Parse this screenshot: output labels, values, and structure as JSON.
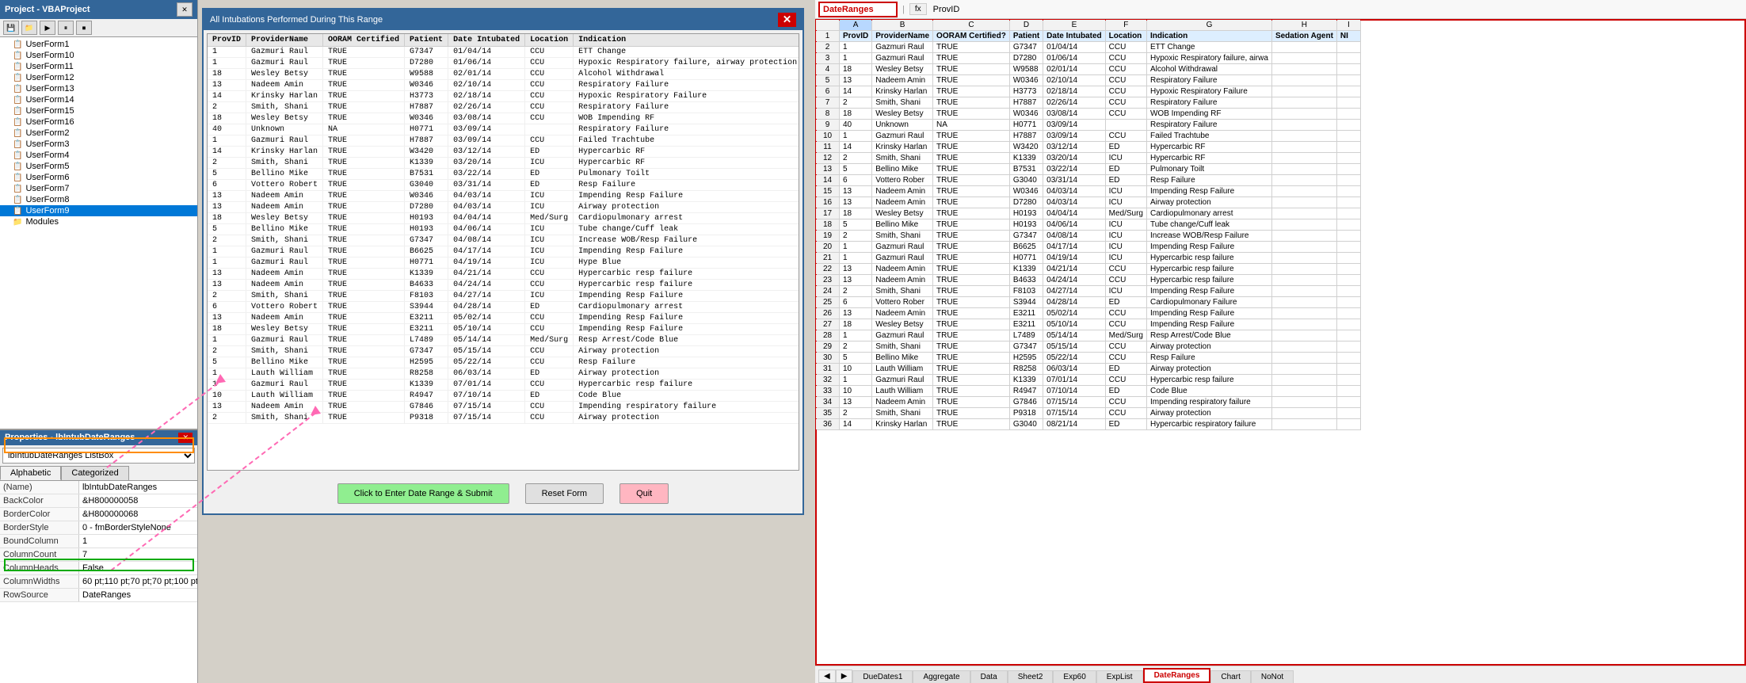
{
  "vba": {
    "title": "Project - VBAProject",
    "toolbar": [
      "save",
      "folder",
      "settings"
    ],
    "tree": [
      {
        "label": "UserForm1",
        "indent": 1,
        "type": "form"
      },
      {
        "label": "UserForm10",
        "indent": 1,
        "type": "form"
      },
      {
        "label": "UserForm11",
        "indent": 1,
        "type": "form"
      },
      {
        "label": "UserForm12",
        "indent": 1,
        "type": "form"
      },
      {
        "label": "UserForm13",
        "indent": 1,
        "type": "form"
      },
      {
        "label": "UserForm14",
        "indent": 1,
        "type": "form"
      },
      {
        "label": "UserForm15",
        "indent": 1,
        "type": "form"
      },
      {
        "label": "UserForm16",
        "indent": 1,
        "type": "form"
      },
      {
        "label": "UserForm2",
        "indent": 1,
        "type": "form"
      },
      {
        "label": "UserForm3",
        "indent": 1,
        "type": "form"
      },
      {
        "label": "UserForm4",
        "indent": 1,
        "type": "form"
      },
      {
        "label": "UserForm5",
        "indent": 1,
        "type": "form"
      },
      {
        "label": "UserForm6",
        "indent": 1,
        "type": "form"
      },
      {
        "label": "UserForm7",
        "indent": 1,
        "type": "form"
      },
      {
        "label": "UserForm8",
        "indent": 1,
        "type": "form"
      },
      {
        "label": "UserForm9",
        "indent": 1,
        "type": "form",
        "selected": true
      },
      {
        "label": "Modules",
        "indent": 1,
        "type": "folder"
      }
    ]
  },
  "properties": {
    "title": "Properties - lbIntubDateRanges",
    "dropdown_value": "lbIntubDateRanges ListBox",
    "tabs": [
      "Alphabetic",
      "Categorized"
    ],
    "active_tab": "Alphabetic",
    "rows": [
      {
        "name": "(Name)",
        "value": "lbIntubDateRanges"
      },
      {
        "name": "BackColor",
        "value": "&H800000058"
      },
      {
        "name": "BorderColor",
        "value": "&H800000068"
      },
      {
        "name": "BorderStyle",
        "value": "0 - fmBorderStyleNone"
      },
      {
        "name": "BoundColumn",
        "value": "1"
      },
      {
        "name": "ColumnCount",
        "value": "7"
      },
      {
        "name": "ColumnHeads",
        "value": "False"
      },
      {
        "name": "ColumnWidths",
        "value": "60 pt;110 pt;70 pt;70 pt;100 pt;70 pt;70 pt"
      },
      {
        "name": "RowSource",
        "value": "DateRanges"
      }
    ]
  },
  "dialog": {
    "title": "All Intubations Performed During This Range",
    "columns": [
      "ProvID",
      "ProviderName",
      "OORAM Certified",
      "Patient",
      "Date Intubated",
      "Location",
      "Indication"
    ],
    "rows": [
      {
        "provid": "1",
        "name": "Gazmuri Raul",
        "cert": "TRUE",
        "patient": "G7347",
        "date": "01/04/14",
        "loc": "CCU",
        "indication": "ETT Change"
      },
      {
        "provid": "1",
        "name": "Gazmuri Raul",
        "cert": "TRUE",
        "patient": "D7280",
        "date": "01/06/14",
        "loc": "CCU",
        "indication": "Hypoxic Respiratory failure, airway protection"
      },
      {
        "provid": "18",
        "name": "Wesley Betsy",
        "cert": "TRUE",
        "patient": "W9588",
        "date": "02/01/14",
        "loc": "CCU",
        "indication": "Alcohol Withdrawal"
      },
      {
        "provid": "13",
        "name": "Nadeem Amin",
        "cert": "TRUE",
        "patient": "W0346",
        "date": "02/10/14",
        "loc": "CCU",
        "indication": "Respiratory Failure"
      },
      {
        "provid": "14",
        "name": "Krinsky Harlan",
        "cert": "TRUE",
        "patient": "H3773",
        "date": "02/18/14",
        "loc": "CCU",
        "indication": "Hypoxic Respiratory Failure"
      },
      {
        "provid": "2",
        "name": "Smith, Shani",
        "cert": "TRUE",
        "patient": "H7887",
        "date": "02/26/14",
        "loc": "CCU",
        "indication": "Respiratory Failure"
      },
      {
        "provid": "18",
        "name": "Wesley Betsy",
        "cert": "TRUE",
        "patient": "W0346",
        "date": "03/08/14",
        "loc": "CCU",
        "indication": "WOB Impending RF"
      },
      {
        "provid": "40",
        "name": "Unknown",
        "cert": "NA",
        "patient": "H0771",
        "date": "03/09/14",
        "loc": "",
        "indication": "Respiratory Failure"
      },
      {
        "provid": "1",
        "name": "Gazmuri Raul",
        "cert": "TRUE",
        "patient": "H7887",
        "date": "03/09/14",
        "loc": "CCU",
        "indication": "Failed Trachtube"
      },
      {
        "provid": "14",
        "name": "Krinsky Harlan",
        "cert": "TRUE",
        "patient": "W3420",
        "date": "03/12/14",
        "loc": "ED",
        "indication": "Hypercarbic RF"
      },
      {
        "provid": "2",
        "name": "Smith, Shani",
        "cert": "TRUE",
        "patient": "K1339",
        "date": "03/20/14",
        "loc": "ICU",
        "indication": "Hypercarbic RF"
      },
      {
        "provid": "5",
        "name": "Bellino Mike",
        "cert": "TRUE",
        "patient": "B7531",
        "date": "03/22/14",
        "loc": "ED",
        "indication": "Pulmonary Toilt"
      },
      {
        "provid": "6",
        "name": "Vottero Robert",
        "cert": "TRUE",
        "patient": "G3040",
        "date": "03/31/14",
        "loc": "ED",
        "indication": "Resp Failure"
      },
      {
        "provid": "13",
        "name": "Nadeem Amin",
        "cert": "TRUE",
        "patient": "W0346",
        "date": "04/03/14",
        "loc": "ICU",
        "indication": "Impending Resp Failure"
      },
      {
        "provid": "13",
        "name": "Nadeem Amin",
        "cert": "TRUE",
        "patient": "D7280",
        "date": "04/03/14",
        "loc": "ICU",
        "indication": "Airway protection"
      },
      {
        "provid": "18",
        "name": "Wesley Betsy",
        "cert": "TRUE",
        "patient": "H0193",
        "date": "04/04/14",
        "loc": "Med/Surg",
        "indication": "Cardiopulmonary arrest"
      },
      {
        "provid": "5",
        "name": "Bellino Mike",
        "cert": "TRUE",
        "patient": "H0193",
        "date": "04/06/14",
        "loc": "ICU",
        "indication": "Tube change/Cuff leak"
      },
      {
        "provid": "2",
        "name": "Smith, Shani",
        "cert": "TRUE",
        "patient": "G7347",
        "date": "04/08/14",
        "loc": "ICU",
        "indication": "Increase WOB/Resp Failure"
      },
      {
        "provid": "1",
        "name": "Gazmuri Raul",
        "cert": "TRUE",
        "patient": "B6625",
        "date": "04/17/14",
        "loc": "ICU",
        "indication": "Impending Resp Failure"
      },
      {
        "provid": "1",
        "name": "Gazmuri Raul",
        "cert": "TRUE",
        "patient": "H0771",
        "date": "04/19/14",
        "loc": "ICU",
        "indication": "Hype Blue"
      },
      {
        "provid": "13",
        "name": "Nadeem Amin",
        "cert": "TRUE",
        "patient": "K1339",
        "date": "04/21/14",
        "loc": "CCU",
        "indication": "Hypercarbic resp failure"
      },
      {
        "provid": "13",
        "name": "Nadeem Amin",
        "cert": "TRUE",
        "patient": "B4633",
        "date": "04/24/14",
        "loc": "CCU",
        "indication": "Hypercarbic resp failure"
      },
      {
        "provid": "2",
        "name": "Smith, Shani",
        "cert": "TRUE",
        "patient": "F8103",
        "date": "04/27/14",
        "loc": "ICU",
        "indication": "Impending Resp Failure"
      },
      {
        "provid": "6",
        "name": "Vottero Robert",
        "cert": "TRUE",
        "patient": "S3944",
        "date": "04/28/14",
        "loc": "ED",
        "indication": "Cardiopulmonary arrest"
      },
      {
        "provid": "13",
        "name": "Nadeem Amin",
        "cert": "TRUE",
        "patient": "E3211",
        "date": "05/02/14",
        "loc": "CCU",
        "indication": "Impending Resp Failure"
      },
      {
        "provid": "18",
        "name": "Wesley Betsy",
        "cert": "TRUE",
        "patient": "E3211",
        "date": "05/10/14",
        "loc": "CCU",
        "indication": "Impending Resp Failure"
      },
      {
        "provid": "1",
        "name": "Gazmuri Raul",
        "cert": "TRUE",
        "patient": "L7489",
        "date": "05/14/14",
        "loc": "Med/Surg",
        "indication": "Resp Arrest/Code Blue"
      },
      {
        "provid": "2",
        "name": "Smith, Shani",
        "cert": "TRUE",
        "patient": "G7347",
        "date": "05/15/14",
        "loc": "CCU",
        "indication": "Airway protection"
      },
      {
        "provid": "5",
        "name": "Bellino Mike",
        "cert": "TRUE",
        "patient": "H2595",
        "date": "05/22/14",
        "loc": "CCU",
        "indication": "Resp Failure"
      },
      {
        "provid": "1",
        "name": "Lauth William",
        "cert": "TRUE",
        "patient": "R8258",
        "date": "06/03/14",
        "loc": "ED",
        "indication": "Airway protection"
      },
      {
        "provid": "1",
        "name": "Gazmuri Raul",
        "cert": "TRUE",
        "patient": "K1339",
        "date": "07/01/14",
        "loc": "CCU",
        "indication": "Hypercarbic resp failure"
      },
      {
        "provid": "10",
        "name": "Lauth William",
        "cert": "TRUE",
        "patient": "R4947",
        "date": "07/10/14",
        "loc": "ED",
        "indication": "Code Blue"
      },
      {
        "provid": "13",
        "name": "Nadeem Amin",
        "cert": "TRUE",
        "patient": "G7846",
        "date": "07/15/14",
        "loc": "CCU",
        "indication": "Impending respiratory failure"
      },
      {
        "provid": "2",
        "name": "Smith, Shani",
        "cert": "TRUE",
        "patient": "P9318",
        "date": "07/15/14",
        "loc": "CCU",
        "indication": "Airway protection"
      }
    ],
    "buttons": [
      {
        "label": "Click to Enter Date Range & Submit",
        "type": "green"
      },
      {
        "label": "Reset Form",
        "type": "default"
      },
      {
        "label": "Quit",
        "type": "pink"
      }
    ]
  },
  "excel": {
    "name_box": "DateRanges",
    "formula": "ProvID",
    "columns": [
      "A",
      "B",
      "C",
      "D",
      "E",
      "F",
      "G",
      "H"
    ],
    "headers": [
      "ProvID",
      "ProviderName",
      "OORAM Certified?",
      "Patient",
      "Date Intubated",
      "Location",
      "Indication",
      "Sedation Agent",
      "NI"
    ],
    "rows": [
      {
        "row": 1,
        "a": "ProvID",
        "b": "ProviderName",
        "c": "OORAM Certified?",
        "d": "Patient",
        "e": "Date Intubated",
        "f": "Location",
        "g": "Indication",
        "h": "Sedation Agent",
        "i": "NI"
      },
      {
        "row": 2,
        "a": "1",
        "b": "Gazmuri Raul",
        "c": "TRUE",
        "d": "G7347",
        "e": "01/04/14",
        "f": "CCU",
        "g": "ETT Change",
        "h": "",
        "i": ""
      },
      {
        "row": 3,
        "a": "1",
        "b": "Gazmuri Raul",
        "c": "TRUE",
        "d": "D7280",
        "e": "01/06/14",
        "f": "CCU",
        "g": "Hypoxic Respiratory failure, airwa",
        "h": "",
        "i": ""
      },
      {
        "row": 4,
        "a": "18",
        "b": "Wesley Betsy",
        "c": "TRUE",
        "d": "W9588",
        "e": "02/01/14",
        "f": "CCU",
        "g": "Alcohol Withdrawal",
        "h": "",
        "i": ""
      },
      {
        "row": 5,
        "a": "13",
        "b": "Nadeem Amin",
        "c": "TRUE",
        "d": "W0346",
        "e": "02/10/14",
        "f": "CCU",
        "g": "Respiratory Failure",
        "h": "",
        "i": ""
      },
      {
        "row": 6,
        "a": "14",
        "b": "Krinsky Harlan",
        "c": "TRUE",
        "d": "H3773",
        "e": "02/18/14",
        "f": "CCU",
        "g": "Hypoxic Respiratory Failure",
        "h": "",
        "i": ""
      },
      {
        "row": 7,
        "a": "2",
        "b": "Smith, Shani",
        "c": "TRUE",
        "d": "H7887",
        "e": "02/26/14",
        "f": "CCU",
        "g": "Respiratory Failure",
        "h": "",
        "i": ""
      },
      {
        "row": 8,
        "a": "18",
        "b": "Wesley Betsy",
        "c": "TRUE",
        "d": "W0346",
        "e": "03/08/14",
        "f": "CCU",
        "g": "WOB Impending RF",
        "h": "",
        "i": ""
      },
      {
        "row": 9,
        "a": "40",
        "b": "Unknown",
        "c": "NA",
        "d": "H0771",
        "e": "03/09/14",
        "f": "",
        "g": "Respiratory Failure",
        "h": "",
        "i": ""
      },
      {
        "row": 10,
        "a": "1",
        "b": "Gazmuri Raul",
        "c": "TRUE",
        "d": "H7887",
        "e": "03/09/14",
        "f": "CCU",
        "g": "Failed Trachtube",
        "h": "",
        "i": ""
      },
      {
        "row": 11,
        "a": "14",
        "b": "Krinsky Harlan",
        "c": "TRUE",
        "d": "W3420",
        "e": "03/12/14",
        "f": "ED",
        "g": "Hypercarbic RF",
        "h": "",
        "i": ""
      },
      {
        "row": 12,
        "a": "2",
        "b": "Smith, Shani",
        "c": "TRUE",
        "d": "K1339",
        "e": "03/20/14",
        "f": "ICU",
        "g": "Hypercarbic RF",
        "h": "",
        "i": ""
      },
      {
        "row": 13,
        "a": "5",
        "b": "Bellino Mike",
        "c": "TRUE",
        "d": "B7531",
        "e": "03/22/14",
        "f": "ED",
        "g": "Pulmonary Toilt",
        "h": "",
        "i": ""
      },
      {
        "row": 14,
        "a": "6",
        "b": "Vottero Rober",
        "c": "TRUE",
        "d": "G3040",
        "e": "03/31/14",
        "f": "ED",
        "g": "Resp Failure",
        "h": "",
        "i": ""
      },
      {
        "row": 15,
        "a": "13",
        "b": "Nadeem Amin",
        "c": "TRUE",
        "d": "W0346",
        "e": "04/03/14",
        "f": "ICU",
        "g": "Impending Resp Failure",
        "h": "",
        "i": ""
      },
      {
        "row": 16,
        "a": "13",
        "b": "Nadeem Amin",
        "c": "TRUE",
        "d": "D7280",
        "e": "04/03/14",
        "f": "ICU",
        "g": "Airway protection",
        "h": "",
        "i": ""
      },
      {
        "row": 17,
        "a": "18",
        "b": "Wesley Betsy",
        "c": "TRUE",
        "d": "H0193",
        "e": "04/04/14",
        "f": "Med/Surg",
        "g": "Cardiopulmonary arrest",
        "h": "",
        "i": ""
      },
      {
        "row": 18,
        "a": "5",
        "b": "Bellino Mike",
        "c": "TRUE",
        "d": "H0193",
        "e": "04/06/14",
        "f": "ICU",
        "g": "Tube change/Cuff leak",
        "h": "",
        "i": ""
      },
      {
        "row": 19,
        "a": "2",
        "b": "Smith, Shani",
        "c": "TRUE",
        "d": "G7347",
        "e": "04/08/14",
        "f": "ICU",
        "g": "Increase WOB/Resp Failure",
        "h": "",
        "i": ""
      },
      {
        "row": 20,
        "a": "1",
        "b": "Gazmuri Raul",
        "c": "TRUE",
        "d": "B6625",
        "e": "04/17/14",
        "f": "ICU",
        "g": "Impending Resp Failure",
        "h": "",
        "i": ""
      },
      {
        "row": 21,
        "a": "1",
        "b": "Gazmuri Raul",
        "c": "TRUE",
        "d": "H0771",
        "e": "04/19/14",
        "f": "ICU",
        "g": "Hypercarbic resp failure",
        "h": "",
        "i": ""
      },
      {
        "row": 22,
        "a": "13",
        "b": "Nadeem Amin",
        "c": "TRUE",
        "d": "K1339",
        "e": "04/21/14",
        "f": "CCU",
        "g": "Hypercarbic resp failure",
        "h": "",
        "i": ""
      },
      {
        "row": 23,
        "a": "13",
        "b": "Nadeem Amin",
        "c": "TRUE",
        "d": "B4633",
        "e": "04/24/14",
        "f": "CCU",
        "g": "Hypercarbic resp failure",
        "h": "",
        "i": ""
      },
      {
        "row": 24,
        "a": "2",
        "b": "Smith, Shani",
        "c": "TRUE",
        "d": "F8103",
        "e": "04/27/14",
        "f": "ICU",
        "g": "Impending Resp Failure",
        "h": "",
        "i": ""
      },
      {
        "row": 25,
        "a": "6",
        "b": "Vottero Rober",
        "c": "TRUE",
        "d": "S3944",
        "e": "04/28/14",
        "f": "ED",
        "g": "Cardiopulmonary Failure",
        "h": "",
        "i": ""
      },
      {
        "row": 26,
        "a": "13",
        "b": "Nadeem Amin",
        "c": "TRUE",
        "d": "E3211",
        "e": "05/02/14",
        "f": "CCU",
        "g": "Impending Resp Failure",
        "h": "",
        "i": ""
      },
      {
        "row": 27,
        "a": "18",
        "b": "Wesley Betsy",
        "c": "TRUE",
        "d": "E3211",
        "e": "05/10/14",
        "f": "CCU",
        "g": "Impending Resp Failure",
        "h": "",
        "i": ""
      },
      {
        "row": 28,
        "a": "1",
        "b": "Gazmuri Raul",
        "c": "TRUE",
        "d": "L7489",
        "e": "05/14/14",
        "f": "Med/Surg",
        "g": "Resp Arrest/Code Blue",
        "h": "",
        "i": ""
      },
      {
        "row": 29,
        "a": "2",
        "b": "Smith, Shani",
        "c": "TRUE",
        "d": "G7347",
        "e": "05/15/14",
        "f": "CCU",
        "g": "Airway protection",
        "h": "",
        "i": ""
      },
      {
        "row": 30,
        "a": "5",
        "b": "Bellino Mike",
        "c": "TRUE",
        "d": "H2595",
        "e": "05/22/14",
        "f": "CCU",
        "g": "Resp Failure",
        "h": "",
        "i": ""
      },
      {
        "row": 31,
        "a": "10",
        "b": "Lauth William",
        "c": "TRUE",
        "d": "R8258",
        "e": "06/03/14",
        "f": "ED",
        "g": "Airway protection",
        "h": "",
        "i": ""
      },
      {
        "row": 32,
        "a": "1",
        "b": "Gazmuri Raul",
        "c": "TRUE",
        "d": "K1339",
        "e": "07/01/14",
        "f": "CCU",
        "g": "Hypercarbic resp failure",
        "h": "",
        "i": ""
      },
      {
        "row": 33,
        "a": "10",
        "b": "Lauth William",
        "c": "TRUE",
        "d": "R4947",
        "e": "07/10/14",
        "f": "ED",
        "g": "Code Blue",
        "h": "",
        "i": ""
      },
      {
        "row": 34,
        "a": "13",
        "b": "Nadeem Amin",
        "c": "TRUE",
        "d": "G7846",
        "e": "07/15/14",
        "f": "CCU",
        "g": "Impending respiratory failure",
        "h": "",
        "i": ""
      },
      {
        "row": 35,
        "a": "2",
        "b": "Smith, Shani",
        "c": "TRUE",
        "d": "P9318",
        "e": "07/15/14",
        "f": "CCU",
        "g": "Airway protection",
        "h": "",
        "i": ""
      },
      {
        "row": 36,
        "a": "14",
        "b": "Krinsky Harlan",
        "c": "TRUE",
        "d": "G3040",
        "e": "08/21/14",
        "f": "ED",
        "g": "Hypercarbic respiratory failure",
        "h": "",
        "i": ""
      }
    ],
    "sheet_tabs": [
      "DueDates1",
      "Aggregate",
      "Data",
      "Sheet2",
      "Exp60",
      "ExpList",
      "DateRanges",
      "Chart",
      "NoNot"
    ],
    "active_tab": "DateRanges"
  }
}
